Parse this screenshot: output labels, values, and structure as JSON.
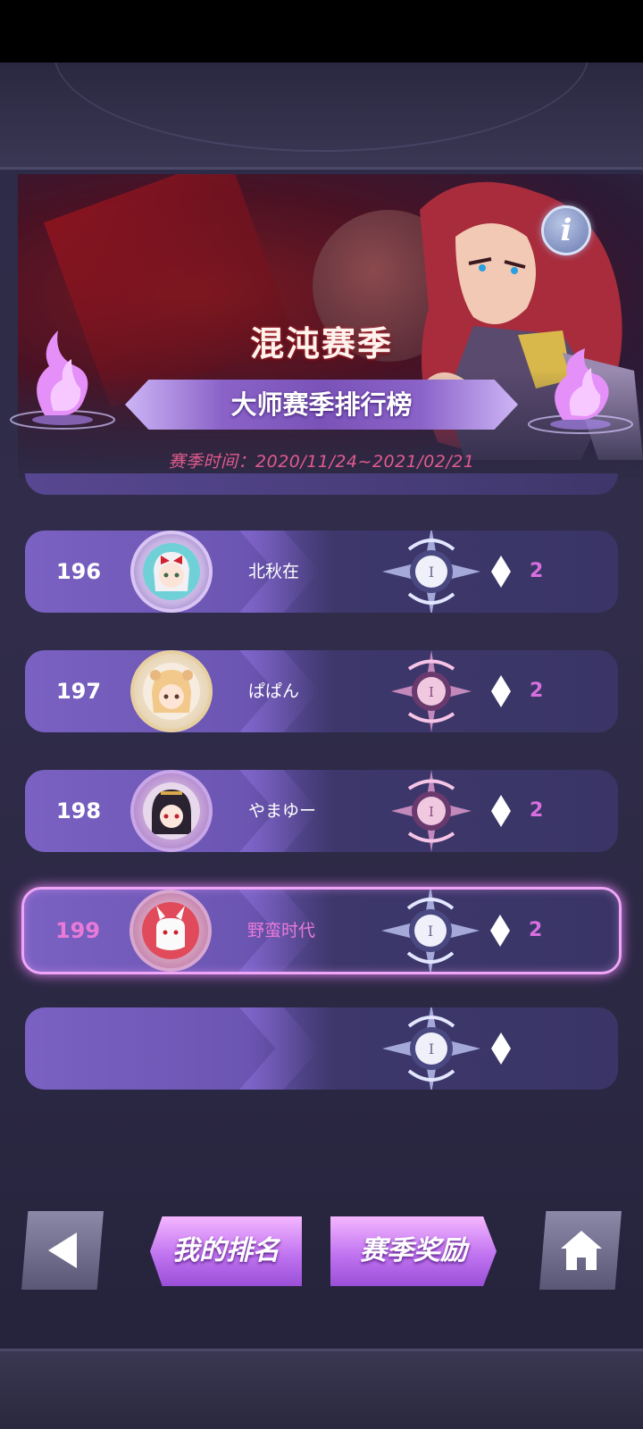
{
  "header": {
    "season_name": "混沌赛季",
    "board_title": "大师赛季排行榜",
    "season_time": "赛季时间：2020/11/24~2021/02/21"
  },
  "rows": [
    {
      "rank": "196",
      "name": "北秋在",
      "score": "2",
      "emblem": "silver"
    },
    {
      "rank": "197",
      "name": "ぱぱん",
      "score": "2",
      "emblem": "pink"
    },
    {
      "rank": "198",
      "name": "やまゆー",
      "score": "2",
      "emblem": "pink"
    },
    {
      "rank": "199",
      "name": "野蛮时代",
      "score": "2",
      "emblem": "silver",
      "highlight": true
    },
    {
      "rank": "",
      "name": "",
      "score": "",
      "emblem": "silver"
    }
  ],
  "buttons": {
    "my_rank": "我的排名",
    "season_reward": "赛季奖励"
  },
  "icons": {
    "info": "i",
    "back": "back-arrow-icon",
    "home": "home-icon"
  },
  "colors": {
    "accent": "#e97ad8",
    "highlight_border": "#f0a6f8",
    "season_time": "#e05b8c"
  }
}
